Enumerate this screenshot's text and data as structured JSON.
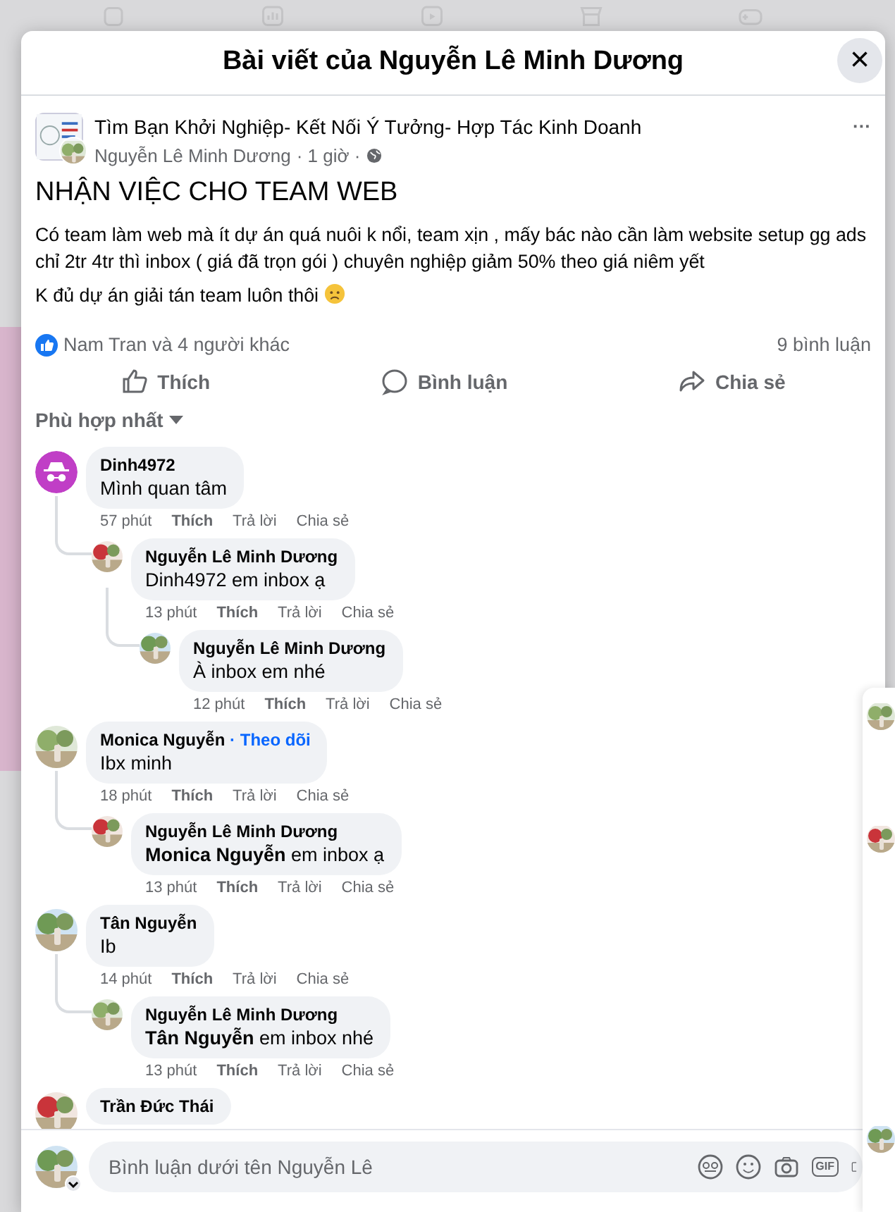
{
  "dialog": {
    "title": "Bài viết của Nguyễn Lê Minh Dương",
    "close_glyph": "×"
  },
  "post": {
    "group": "Tìm Bạn Khởi Nghiệp- Kết Nối Ý Tưởng- Hợp Tác Kinh Doanh",
    "author": "Nguyễn Lê Minh Dương",
    "time": "· 1 giờ ·",
    "more_glyph": "···",
    "headline": "NHẬN VIỆC CHO TEAM WEB",
    "paragraphs": [
      "Có team làm web mà ít dự án quá nuôi k nổi, team xịn , mấy bác nào cần làm website setup gg ads chỉ 2tr 4tr thì inbox ( giá đã trọn gói ) chuyên nghiệp giảm 50% theo giá niêm yết",
      "K đủ dự án giải tán team luôn thôi"
    ],
    "reactions": "Nam Tran và 4 người khác",
    "comment_count": "9 bình luận",
    "actions": [
      {
        "kind": "like",
        "label": "Thích"
      },
      {
        "kind": "comment",
        "label": "Bình luận"
      },
      {
        "kind": "share",
        "label": "Chia sẻ"
      }
    ]
  },
  "sort": {
    "label": "Phù hợp nhất"
  },
  "comments": [
    {
      "kind": "anonymous",
      "name": "Dinh4972",
      "text": "Mình quan tâm",
      "time": "57 phút",
      "like": "Thích",
      "reply": "Trả lời",
      "share": "Chia sẻ",
      "children": [
        {
          "kind": "picture",
          "name": "Nguyễn Lê Minh Dương",
          "text": "Dinh4972 em inbox ạ",
          "time": "13 phút",
          "like": "Thích",
          "reply": "Trả lời",
          "share": "Chia sẻ",
          "children": [
            {
              "kind": "picture",
              "name": "Nguyễn Lê Minh Dương",
              "text": "À inbox em nhé",
              "time": "12 phút",
              "like": "Thích",
              "reply": "Trả lời",
              "share": "Chia sẻ"
            }
          ]
        }
      ]
    },
    {
      "kind": "picture",
      "name": "Monica Nguyễn",
      "follow": "· Theo dõi",
      "text": "Ibx minh",
      "time": "18 phút",
      "like": "Thích",
      "reply": "Trả lời",
      "share": "Chia sẻ",
      "children": [
        {
          "kind": "picture",
          "name": "Nguyễn Lê Minh Dương",
          "text": "**Monica Nguyễn** em inbox ạ",
          "time": "13 phút",
          "like": "Thích",
          "reply": "Trả lời",
          "share": "Chia sẻ"
        }
      ]
    },
    {
      "kind": "picture",
      "name": "Tân Nguyễn",
      "text": "Ib",
      "time": "14 phút",
      "like": "Thích",
      "reply": "Trả lời",
      "share": "Chia sẻ",
      "children": [
        {
          "kind": "picture",
          "name": "Nguyễn Lê Minh Dương",
          "text": "**Tân Nguyễn** em inbox nhé",
          "time": "13 phút",
          "like": "Thích",
          "reply": "Trả lời",
          "share": "Chia sẻ"
        }
      ]
    },
    {
      "kind": "picture",
      "name": "Trần Đức Thái"
    }
  ],
  "composer": {
    "placeholder": "Bình luận dưới tên Nguyễn Lê",
    "gif_label": "GIF"
  }
}
